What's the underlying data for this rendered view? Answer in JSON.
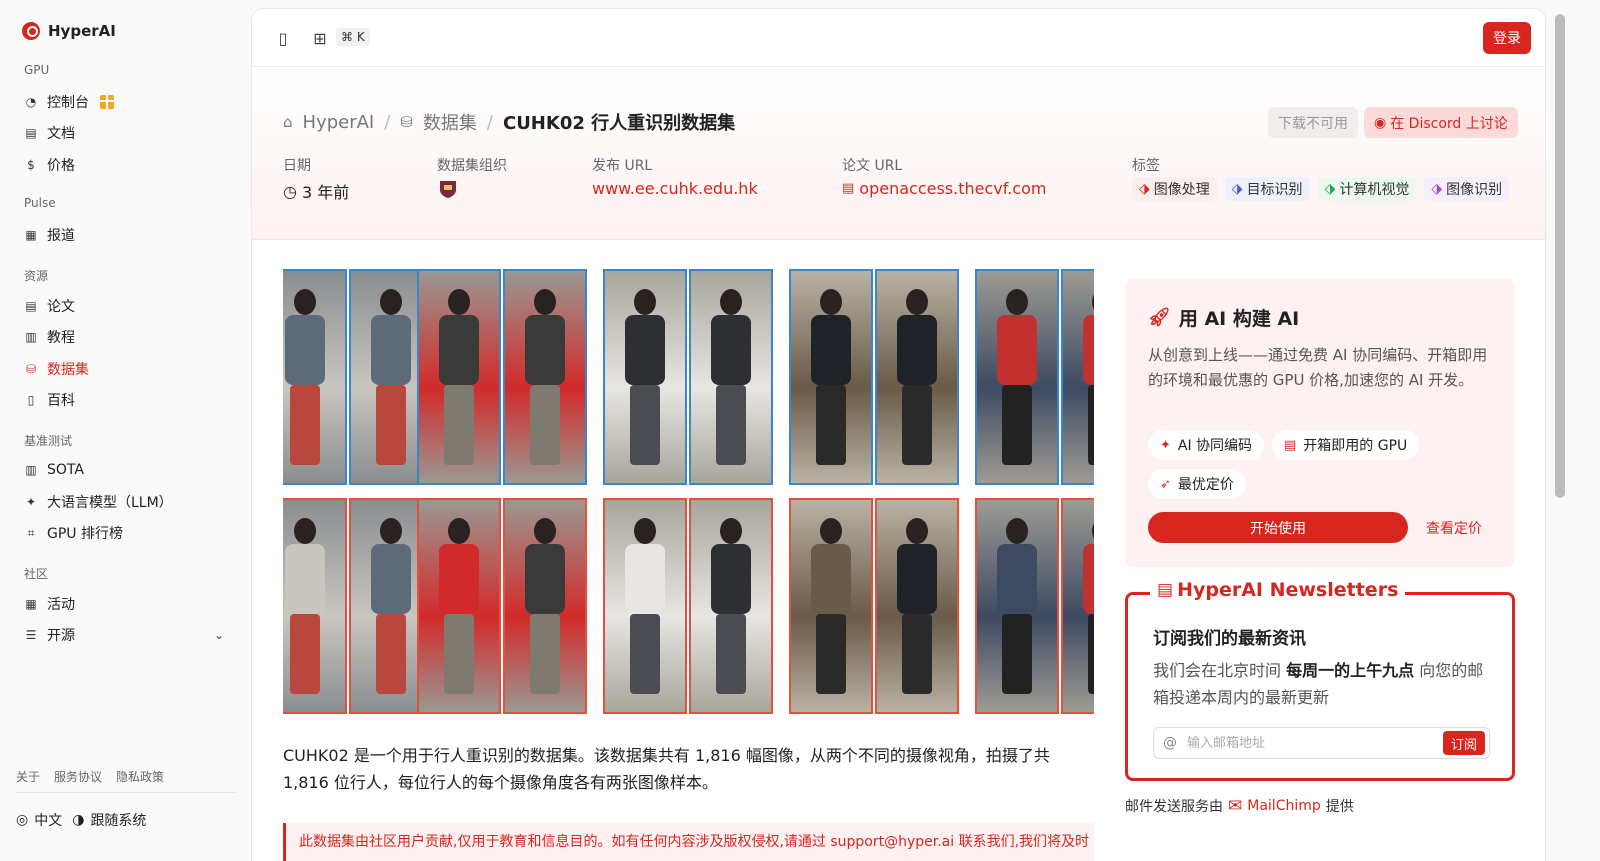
{
  "brand": {
    "name": "HyperAI"
  },
  "sidebar": {
    "sections": [
      {
        "title": "GPU",
        "items": [
          {
            "label": "控制台",
            "icon": "dashboard-icon"
          },
          {
            "label": "文档",
            "icon": "doc-icon"
          },
          {
            "label": "价格",
            "icon": "price-icon"
          }
        ]
      },
      {
        "title": "Pulse",
        "items": [
          {
            "label": "报道",
            "icon": "news-icon"
          }
        ]
      },
      {
        "title": "资源",
        "items": [
          {
            "label": "论文",
            "icon": "paper-icon"
          },
          {
            "label": "教程",
            "icon": "book-icon"
          },
          {
            "label": "数据集",
            "icon": "database-icon",
            "active": true
          },
          {
            "label": "百科",
            "icon": "wiki-icon"
          }
        ]
      },
      {
        "title": "基准测试",
        "items": [
          {
            "label": "SOTA",
            "icon": "chart-icon"
          },
          {
            "label": "大语言模型（LLM）",
            "icon": "sparkle-icon"
          },
          {
            "label": "GPU 排行榜",
            "icon": "chip-icon"
          }
        ]
      },
      {
        "title": "社区",
        "items": [
          {
            "label": "活动",
            "icon": "calendar-icon"
          },
          {
            "label": "开源",
            "icon": "list-icon"
          }
        ]
      }
    ],
    "footer_links": [
      "关于",
      "服务协议",
      "隐私政策"
    ],
    "language": "中文",
    "theme": "跟随系统"
  },
  "topbar": {
    "shortcut": "⌘ K",
    "login_label": "登录"
  },
  "breadcrumb": {
    "home": "HyperAI",
    "section": "数据集",
    "current": "CUHK02 行人重识别数据集"
  },
  "actions": {
    "download": "下载不可用",
    "discord": "在 Discord 上讨论"
  },
  "meta": {
    "date_label": "日期",
    "date_value": "3 年前",
    "org_label": "数据集组织",
    "url_label": "发布 URL",
    "url_value": "www.ee.cuhk.edu.hk",
    "paper_label": "论文 URL",
    "paper_value": "openaccess.thecvf.com",
    "tags_label": "标签",
    "tags": [
      "图像处理",
      "目标识别",
      "计算机视觉",
      "图像识别"
    ]
  },
  "description": "CUHK02 是一个用于行人重识别的数据集。该数据集共有 1,816 幅图像，从两个不同的摄像视角，拍摄了共 1,816 位行人，每位行人的每个摄像角度各有两张图像样本。",
  "notice": "此数据集由社区用户贡献,仅用于教育和信息目的。如有任何内容涉及版权侵权,请通过 support@hyper.ai 联系我们,我们将及时",
  "ai_card": {
    "title": "用 AI 构建 AI",
    "text": "从创意到上线——通过免费 AI 协同编码、开箱即用的环境和最优惠的 GPU 价格,加速您的 AI 开发。",
    "chips": [
      "AI 协同编码",
      "开箱即用的 GPU",
      "最优定价"
    ],
    "start_label": "开始使用",
    "pricing_label": "查看定价"
  },
  "newsletter": {
    "title": "HyperAI Newsletters",
    "heading": "订阅我们的最新资讯",
    "text_pre": "我们会在北京时间 ",
    "text_bold": "每周一的上午九点",
    "text_post": " 向您的邮箱投递本周内的最新更新",
    "placeholder": "输入邮箱地址",
    "subscribe_label": "订阅"
  },
  "mail_by": {
    "pre": "邮件发送服务由",
    "brand": "MailChimp",
    "post": "提供"
  }
}
